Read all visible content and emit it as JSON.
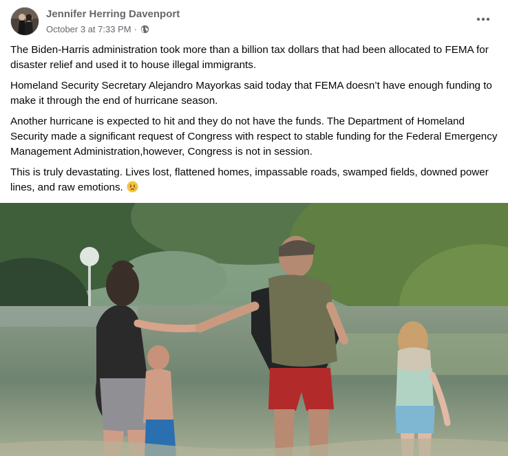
{
  "post": {
    "author": "Jennifer Herring Davenport",
    "timestamp": "October 3 at 7:33 PM",
    "separator": "·",
    "audience_icon": "globe-icon",
    "more_icon": "more-options-icon",
    "paragraphs": [
      "The Biden-Harris administration took more than a billion tax dollars that had been allocated to FEMA for disaster relief and used it to house illegal immigrants.",
      "Homeland Security Secretary Alejandro Mayorkas said today that FEMA doesn’t have enough funding to make it through the end of hurricane season.",
      "Another hurricane is expected to hit and they do not have the funds. The Department of Homeland Security made a significant request of Congress with respect to stable funding for the Federal Emergency Management Administration,however, Congress is not in session.",
      "This is truly devastating. Lives lost, flattened homes, impassable roads, swamped fields, downed power lines, and raw emotions."
    ],
    "emoji": "sad-but-relieved-face-emoji"
  },
  "colors": {
    "secondary_text": "#65676b",
    "primary_text": "#050505",
    "background": "#ffffff"
  }
}
